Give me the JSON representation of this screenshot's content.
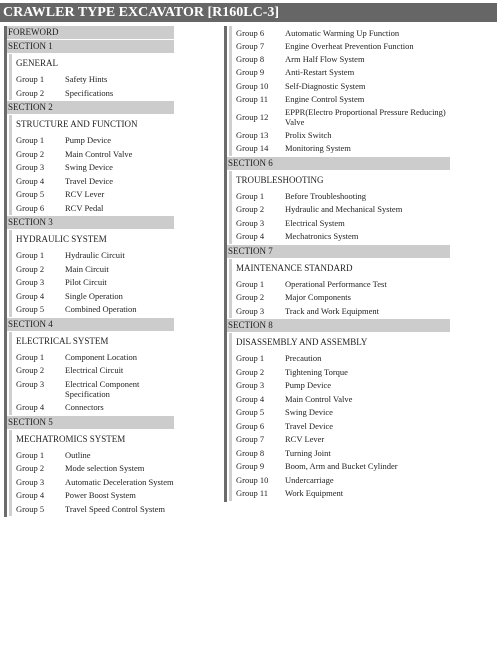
{
  "title": "CRAWLER TYPE EXCAVATOR [R160LC-3]",
  "left_column": {
    "foreword": "FOREWORD",
    "sections": [
      {
        "label": "SECTION 1",
        "title": "GENERAL",
        "groups": [
          {
            "group": "Group 1",
            "name": "Safety Hints"
          },
          {
            "group": "Group 2",
            "name": "Specifications"
          }
        ]
      },
      {
        "label": "SECTION 2",
        "title": "STRUCTURE AND FUNCTION",
        "groups": [
          {
            "group": "Group 1",
            "name": "Pump Device"
          },
          {
            "group": "Group 2",
            "name": "Main Control Valve"
          },
          {
            "group": "Group 3",
            "name": "Swing Device"
          },
          {
            "group": "Group 4",
            "name": "Travel Device"
          },
          {
            "group": "Group 5",
            "name": "RCV Lever"
          },
          {
            "group": "Group 6",
            "name": "RCV Pedal"
          }
        ]
      },
      {
        "label": "SECTION 3",
        "title": "HYDRAULIC SYSTEM",
        "groups": [
          {
            "group": "Group 1",
            "name": "Hydraulic Circuit"
          },
          {
            "group": "Group 2",
            "name": "Main Circuit"
          },
          {
            "group": "Group 3",
            "name": "Pilot Circuit"
          },
          {
            "group": "Group 4",
            "name": "Single Operation"
          },
          {
            "group": "Group 5",
            "name": "Combined Operation"
          }
        ]
      },
      {
        "label": "SECTION 4",
        "title": "ELECTRICAL SYSTEM",
        "groups": [
          {
            "group": "Group 1",
            "name": "Component Location"
          },
          {
            "group": "Group 2",
            "name": "Electrical Circuit"
          },
          {
            "group": "Group 3",
            "name": "Electrical Component Specification"
          },
          {
            "group": "Group 4",
            "name": "Connectors"
          }
        ]
      },
      {
        "label": "SECTION 5",
        "title": "MECHATROMICS SYSTEM",
        "groups": [
          {
            "group": "Group 1",
            "name": "Outline"
          },
          {
            "group": "Group 2",
            "name": "Mode selection System"
          },
          {
            "group": "Group 3",
            "name": "Automatic Deceleration System"
          },
          {
            "group": "Group 4",
            "name": "Power Boost System"
          },
          {
            "group": "Group 5",
            "name": "Travel Speed Control System"
          }
        ]
      }
    ]
  },
  "right_column": {
    "continued_groups": [
      {
        "group": "Group 6",
        "name": "Automatic Warming Up Function"
      },
      {
        "group": "Group 7",
        "name": "Engine Overheat Prevention Function"
      },
      {
        "group": "Group 8",
        "name": "Arm Half Flow System"
      },
      {
        "group": "Group 9",
        "name": "Anti-Restart System"
      },
      {
        "group": "Group 10",
        "name": "Self-Diagnostic System"
      },
      {
        "group": "Group 11",
        "name": "Engine Control System"
      },
      {
        "group": "Group 12",
        "name": "EPPR(Electro Proportional Pressure Reducing) Valve"
      },
      {
        "group": "Group 13",
        "name": "Prolix Switch"
      },
      {
        "group": "Group 14",
        "name": "Monitoring System"
      }
    ],
    "sections": [
      {
        "label": "SECTION 6",
        "title": "TROUBLESHOOTING",
        "groups": [
          {
            "group": "Group 1",
            "name": "Before Troubleshooting"
          },
          {
            "group": "Group 2",
            "name": "Hydraulic and Mechanical System"
          },
          {
            "group": "Group 3",
            "name": "Electrical System"
          },
          {
            "group": "Group 4",
            "name": "Mechatronics System"
          }
        ]
      },
      {
        "label": "SECTION 7",
        "title": "MAINTENANCE STANDARD",
        "groups": [
          {
            "group": "Group 1",
            "name": "Operational Performance Test"
          },
          {
            "group": "Group 2",
            "name": "Major Components"
          },
          {
            "group": "Group 3",
            "name": "Track and Work Equipment"
          }
        ]
      },
      {
        "label": "SECTION 8",
        "title": "DISASSEMBLY AND ASSEMBLY",
        "groups": [
          {
            "group": "Group 1",
            "name": "Precaution"
          },
          {
            "group": "Group 2",
            "name": "Tightening Torque"
          },
          {
            "group": "Group 3",
            "name": "Pump Device"
          },
          {
            "group": "Group 4",
            "name": "Main Control Valve"
          },
          {
            "group": "Group 5",
            "name": "Swing Device"
          },
          {
            "group": "Group 6",
            "name": "Travel Device"
          },
          {
            "group": "Group 7",
            "name": "RCV Lever"
          },
          {
            "group": "Group 8",
            "name": "Turning Joint"
          },
          {
            "group": "Group 9",
            "name": "Boom, Arm and Bucket Cylinder"
          },
          {
            "group": "Group 10",
            "name": "Undercarriage"
          },
          {
            "group": "Group 11",
            "name": "Work Equipment"
          }
        ]
      }
    ]
  }
}
